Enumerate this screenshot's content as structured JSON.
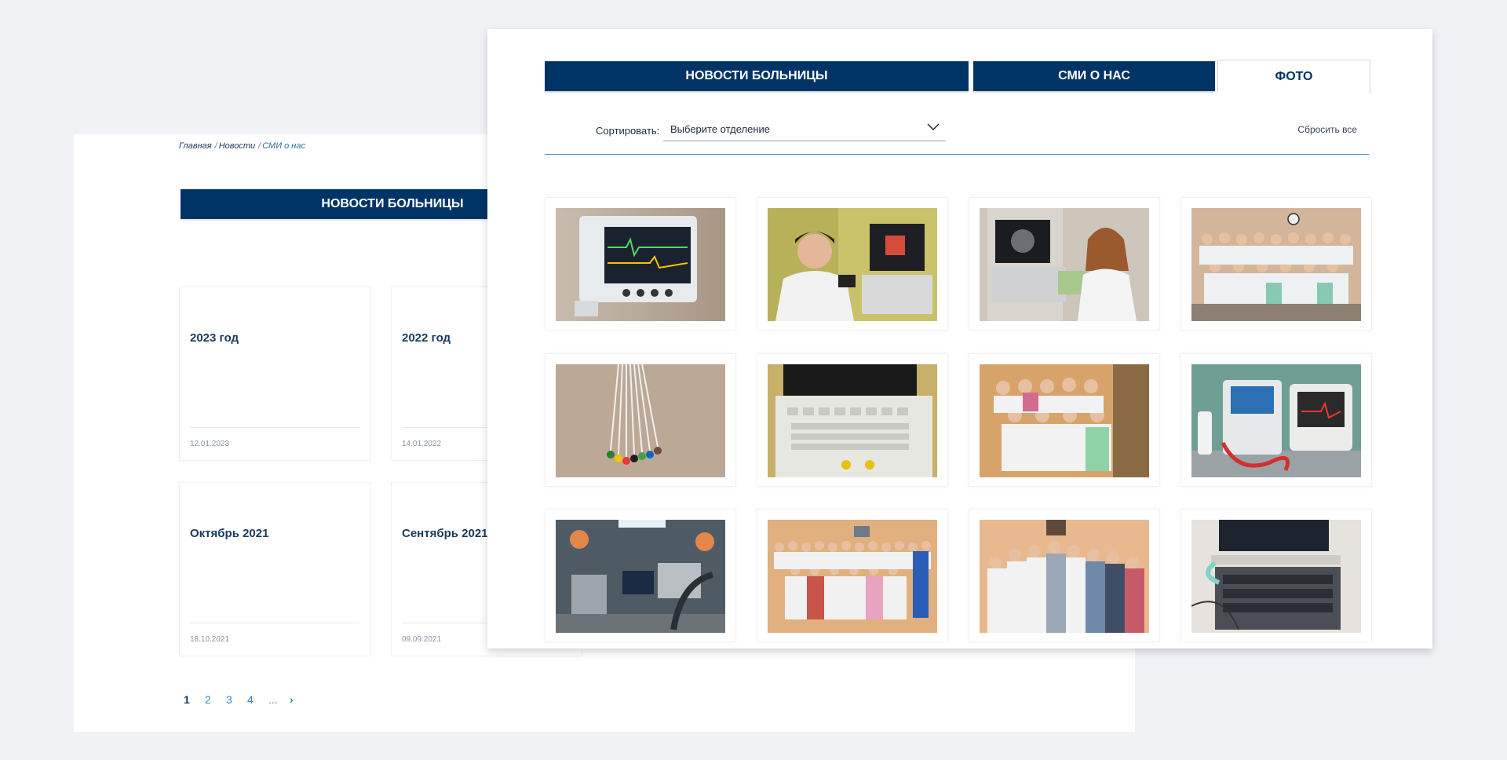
{
  "back_page": {
    "breadcrumb": [
      {
        "label": "Главная"
      },
      {
        "label": "Новости"
      },
      {
        "label": "СМИ о нас"
      }
    ],
    "tab_label": "НОВОСТИ БОЛЬНИЦЫ",
    "cards": [
      {
        "title": "2023 год",
        "date": "12.01.2023"
      },
      {
        "title": "2022 год",
        "date": "14.01.2022"
      },
      {
        "title": "Октябрь 2021",
        "date": "18.10.2021"
      },
      {
        "title": "Сентябрь 2021",
        "date": "09.09.2021"
      }
    ],
    "pagination": {
      "pages": [
        "1",
        "2",
        "3",
        "4"
      ],
      "ellipsis": "...",
      "next": "›"
    }
  },
  "front_page": {
    "tabs": [
      {
        "label": "НОВОСТИ БОЛЬНИЦЫ",
        "active": false
      },
      {
        "label": "СМИ О НАС",
        "active": false
      },
      {
        "label": "ФОТО",
        "active": true
      }
    ],
    "sort": {
      "label": "Сортировать:",
      "value": "Выберите отделение",
      "reset_label": "Сбросить все"
    },
    "photos": [
      {
        "name": "photo-patient-monitor-icon"
      },
      {
        "name": "photo-doctor-ultrasound-icon"
      },
      {
        "name": "photo-ultrasound-machine-doctor-icon"
      },
      {
        "name": "photo-staff-group-icon"
      },
      {
        "name": "photo-ecg-cables-icon"
      },
      {
        "name": "photo-ultrasound-keyboard-icon"
      },
      {
        "name": "photo-doctors-group-office-icon"
      },
      {
        "name": "photo-defibrillator-icon"
      },
      {
        "name": "photo-operating-room-icon"
      },
      {
        "name": "photo-large-staff-group-icon"
      },
      {
        "name": "photo-staff-group-standing-icon"
      },
      {
        "name": "photo-endoscopy-cart-icon"
      }
    ]
  }
}
